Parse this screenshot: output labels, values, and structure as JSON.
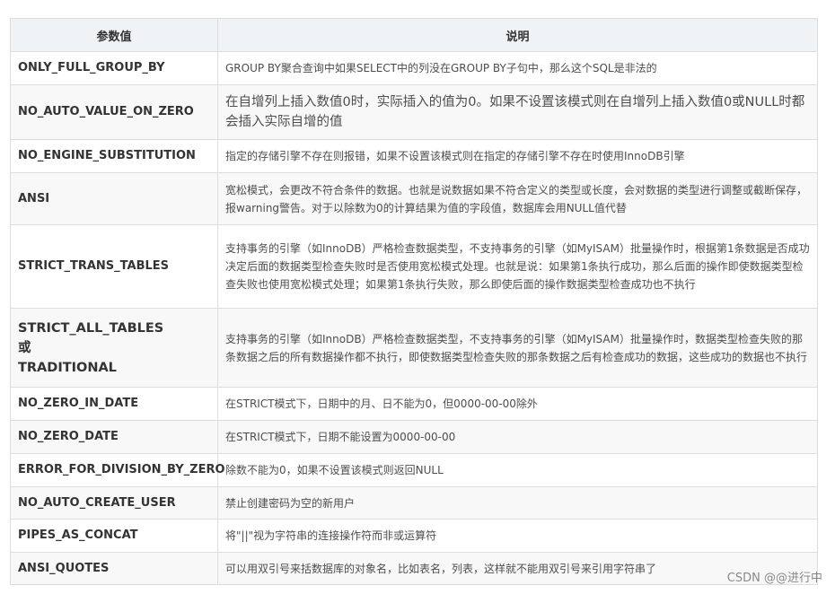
{
  "table": {
    "headers": [
      "参数值",
      "说明"
    ],
    "rows": [
      {
        "key": "ONLY_FULL_GROUP_BY",
        "desc": "GROUP BY聚合查询中如果SELECT中的列没在GROUP BY子句中，那么这个SQL是非法的"
      },
      {
        "key": "NO_AUTO_VALUE_ON_ZERO",
        "desc": "在自增列上插入数值0时，实际插入的值为0。如果不设置该模式则在自增列上插入数值0或NULL时都会插入实际自增的值"
      },
      {
        "key": "NO_ENGINE_SUBSTITUTION",
        "desc": "指定的存储引擎不存在则报错，如果不设置该模式则在指定的存储引擎不存在时使用InnoDB引擎"
      },
      {
        "key": "ANSI",
        "desc": "宽松模式，会更改不符合条件的数据。也就是说数据如果不符合定义的类型或长度，会对数据的类型进行调整或截断保存，报warning警告。对于以除数为0的计算结果为值的字段值，数据库会用NULL值代替"
      },
      {
        "key": "STRICT_TRANS_TABLES",
        "desc": "支持事务的引擎（如InnoDB）严格检查数据类型，不支持事务的引擎（如MyISAM）批量操作时，根据第1条数据是否成功决定后面的数据类型检查失败时是否使用宽松模式处理。也就是说：如果第1条执行成功，那么后面的操作即使数据类型检查失败也使用宽松模式处理；如果第1条执行失败，那么即使后面的操作数据类型检查成功也不执行"
      },
      {
        "key": "STRICT_ALL_TABLES",
        "key_or": "或",
        "key_alt": "TRADITIONAL",
        "desc": "支持事务的引擎（如InnoDB）严格检查数据类型，不支持事务的引擎（如MyISAM）批量操作时，数据类型检查失败的那条数据之后的所有数据操作都不执行，即使数据类型检查失败的那条数据之后有检查成功的数据，这些成功的数据也不执行"
      },
      {
        "key": "NO_ZERO_IN_DATE",
        "desc": "在STRICT模式下，日期中的月、日不能为0，但0000-00-00除外"
      },
      {
        "key": "NO_ZERO_DATE",
        "desc": "在STRICT模式下，日期不能设置为0000-00-00"
      },
      {
        "key": "ERROR_FOR_DIVISION_BY_ZERO",
        "desc": "除数不能为0，如果不设置该模式则返回NULL"
      },
      {
        "key": "NO_AUTO_CREATE_USER",
        "desc": "禁止创建密码为空的新用户"
      },
      {
        "key": "PIPES_AS_CONCAT",
        "desc": "将\"||\"视为字符串的连接操作符而非或运算符"
      },
      {
        "key": "ANSI_QUOTES",
        "desc": "可以用双引号来括数据库的对象名，比如表名，列表，这样就不能用双引号来引用字符串了"
      }
    ]
  },
  "watermark": "CSDN @@进行中"
}
